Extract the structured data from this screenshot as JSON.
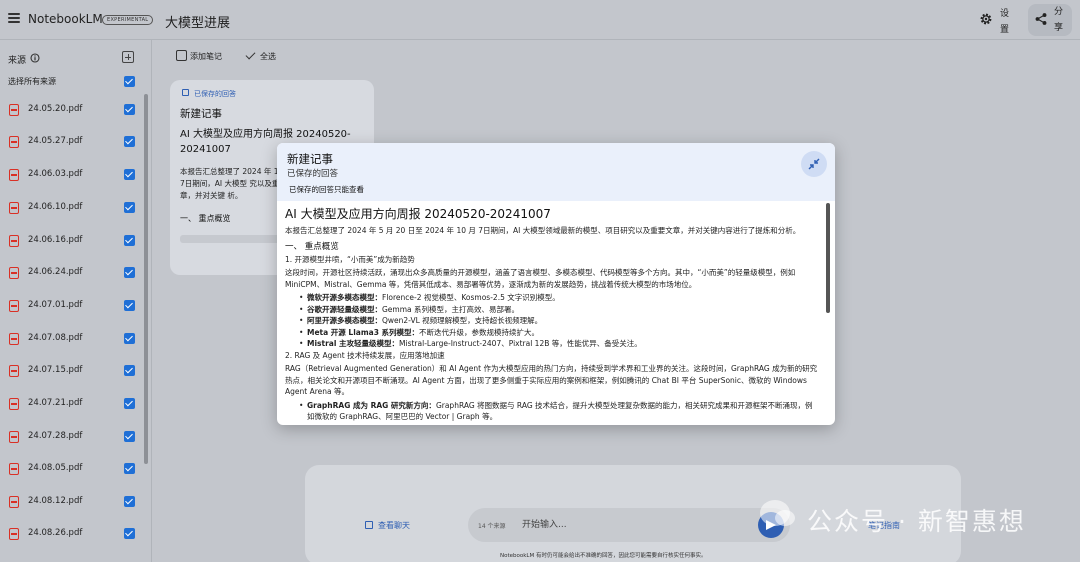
{
  "app": {
    "brand": "NotebookLM",
    "badge": "EXPERIMENTAL",
    "notebook_title": "大模型进展",
    "settings_label": "设置",
    "share_label": "分享"
  },
  "sidebar": {
    "heading": "来源",
    "select_all": "选择所有来源",
    "items": [
      {
        "name": "24.05.20.pdf"
      },
      {
        "name": "24.05.27.pdf"
      },
      {
        "name": "24.06.03.pdf"
      },
      {
        "name": "24.06.10.pdf"
      },
      {
        "name": "24.06.16.pdf"
      },
      {
        "name": "24.06.24.pdf"
      },
      {
        "name": "24.07.01.pdf"
      },
      {
        "name": "24.07.08.pdf"
      },
      {
        "name": "24.07.15.pdf"
      },
      {
        "name": "24.07.21.pdf"
      },
      {
        "name": "24.07.28.pdf"
      },
      {
        "name": "24.08.05.pdf"
      },
      {
        "name": "24.08.12.pdf"
      },
      {
        "name": "24.08.26.pdf"
      }
    ]
  },
  "toolbar": {
    "add_note": "添加笔记",
    "select_all": "全选"
  },
  "note_card": {
    "saved_label": "已保存的回答",
    "title": "新建记事",
    "heading": "AI 大模型及应用方向周报 20240520-20241007",
    "body": "本报告汇总整理了 2024 年 10 月 7日期间，AI 大模型 究以及重要文章，并对关键 析。",
    "section": "一、 重点概览"
  },
  "modal": {
    "title": "新建记事",
    "subtitle": "已保存的回答",
    "readonly_note": "已保存的回答只能查看",
    "heading": "AI 大模型及应用方向周报 20240520-20241007",
    "intro": "本报告汇总整理了 2024 年 5 月 20 日至 2024 年 10 月 7日期间，AI 大模型领域最新的模型、项目研究以及重要文章，并对关键内容进行了提炼和分析。",
    "section1": "一、 重点概览",
    "item1_title": "1. 开源模型井喷，“小而美”成为新趋势",
    "item1_body": "这段时间，开源社区持续活跃，涌现出众多高质量的开源模型，涵盖了语言模型、多模态模型、代码模型等多个方向。其中，“小而美”的轻量级模型，例如 MiniCPM、Mistral、Gemma 等，凭借其低成本、易部署等优势，逐渐成为新的发展趋势，挑战着传统大模型的市场地位。",
    "bullets1": [
      {
        "label": "微软开源多模态模型：",
        "text": "Florence-2 视觉模型、Kosmos-2.5 文字识别模型。"
      },
      {
        "label": "谷歌开源轻量级模型：",
        "text": "Gemma 系列模型，主打高效、易部署。"
      },
      {
        "label": "阿里开源多模态模型：",
        "text": "Qwen2-VL 视频理解模型，支持超长视频理解。"
      },
      {
        "label": "Meta 开源 Llama3 系列模型：",
        "text": "不断迭代升级，参数规模持续扩大。"
      },
      {
        "label": "Mistral 主攻轻量级模型：",
        "text": "Mistral-Large-Instruct-2407、Pixtral 12B 等，性能优异、备受关注。"
      }
    ],
    "item2_title": "2. RAG 及 Agent 技术持续发展，应用落地加速",
    "item2_body": "RAG（Retrieval Augmented Generation）和 AI Agent 作为大模型应用的热门方向，持续受到学术界和工业界的关注。这段时间，GraphRAG 成为新的研究热点，相关论文和开源项目不断涌现。AI Agent 方面，出现了更多侧重于实际应用的案例和框架，例如腾讯的 Chat BI 平台 SuperSonic、微软的 Windows Agent Arena 等。",
    "bullets2": [
      {
        "label": "GraphRAG 成为 RAG 研究新方向：",
        "text": "GraphRAG 将图数据与 RAG 技术结合，提升大模型处理复杂数据的能力，相关研究成果和开源框架不断涌现，例如微软的 GraphRAG、阿里巴巴的 Vector | Graph 等。"
      }
    ]
  },
  "chat": {
    "view_chat": "查看聊天",
    "source_count": "14 个来源",
    "placeholder": "开始输入...",
    "right_label": "笔记指南",
    "disclaimer": "NotebookLM 有时仍可能会给出不准确的回答，因此您可能需要自行核实任何事实。"
  },
  "watermark": "公众号 · 新智惠想",
  "colors": {
    "accent": "#1f6fd6",
    "pdf": "#d93025",
    "link": "#2f5fb3"
  }
}
